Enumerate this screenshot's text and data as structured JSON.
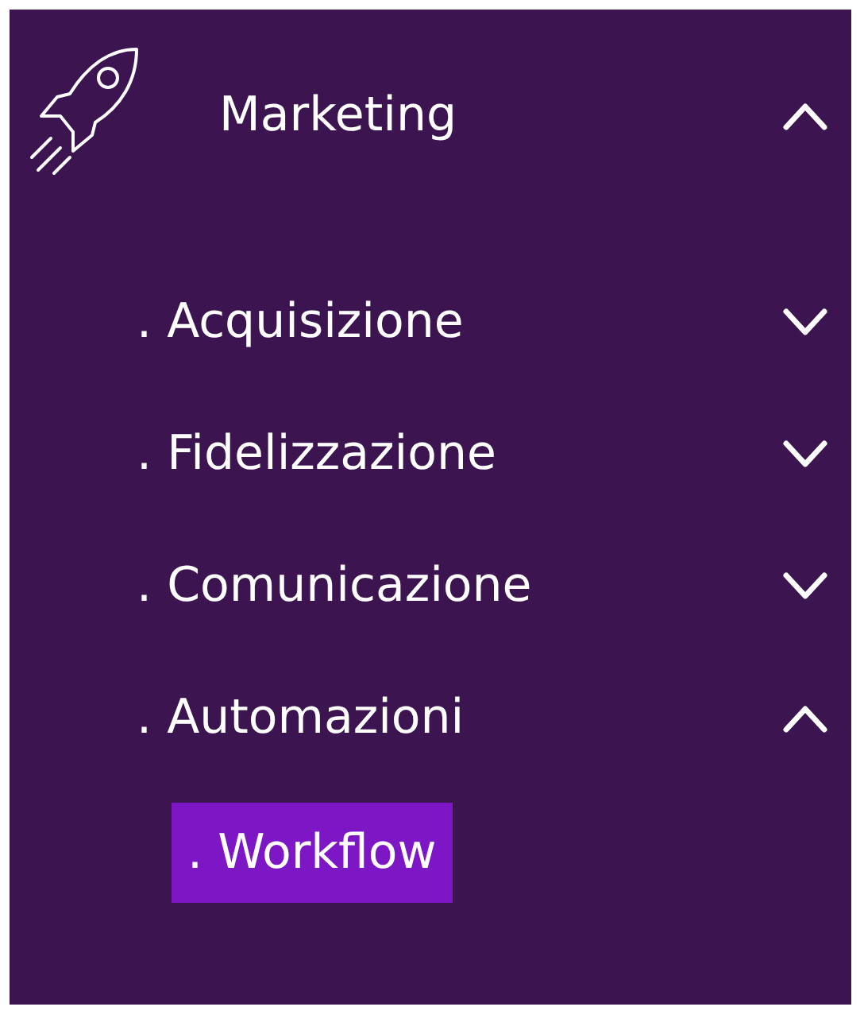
{
  "menu": {
    "title": "Marketing",
    "expanded": true,
    "items": [
      {
        "label": ". Acquisizione",
        "expanded": false
      },
      {
        "label": ". Fidelizzazione",
        "expanded": false
      },
      {
        "label": ". Comunicazione",
        "expanded": false
      },
      {
        "label": ". Automazioni",
        "expanded": true,
        "children": [
          {
            "label": ". Workflow",
            "selected": true
          }
        ]
      }
    ]
  }
}
